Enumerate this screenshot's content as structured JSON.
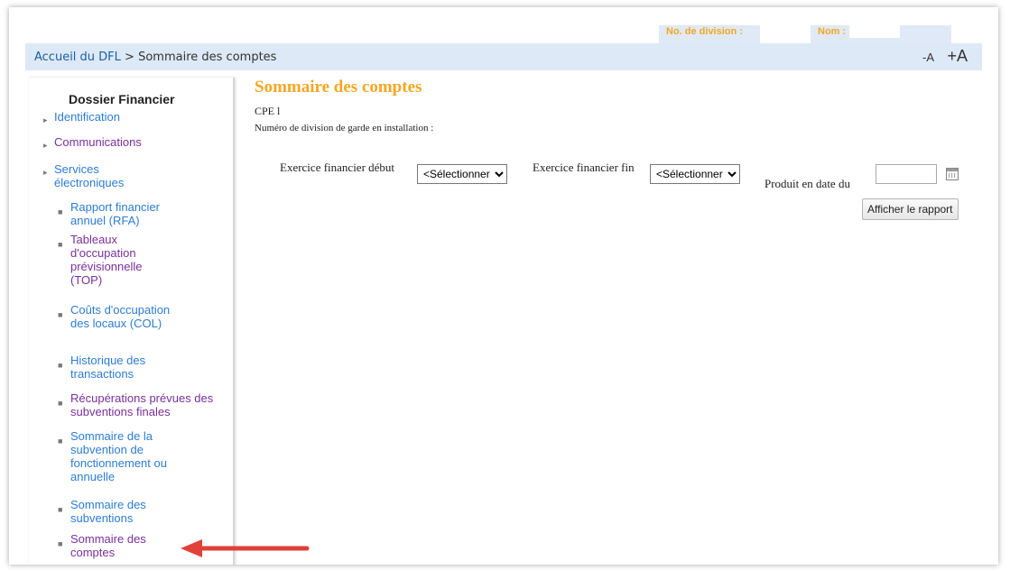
{
  "header": {
    "division_label": "No. de division :",
    "name_label": "Nom :"
  },
  "breadcrumb": {
    "home": "Accueil du DFL",
    "separator": " > ",
    "current": "Sommaire des comptes"
  },
  "font_controls": {
    "decrease": "-A",
    "increase": "+A"
  },
  "sidebar": {
    "title": "Dossier Financier",
    "items": [
      {
        "label": "Identification",
        "color": "blue"
      },
      {
        "label": "Communications",
        "color": "purple"
      },
      {
        "label": "Services électroniques",
        "color": "blue"
      }
    ],
    "subitems": [
      {
        "label": "Rapport financier annuel (RFA)",
        "color": "blue"
      },
      {
        "label": "Tableaux d'occupation prévisionnelle (TOP)",
        "color": "purple"
      },
      {
        "label": "Coûts d'occupation des locaux (COL)",
        "color": "blue"
      },
      {
        "label": "Historique des transactions",
        "color": "blue"
      },
      {
        "label": "Récupérations prévues des subventions finales",
        "color": "purple"
      },
      {
        "label": "Sommaire de la subvention de fonctionnement ou annuelle",
        "color": "blue"
      },
      {
        "label": "Sommaire des subventions",
        "color": "blue"
      },
      {
        "label": "Sommaire des comptes",
        "color": "purple"
      }
    ]
  },
  "main": {
    "title": "Sommaire des comptes",
    "cpe": "CPE l",
    "division_line": "Numéro de division de garde en installation :",
    "fiscal_start_label": "Exercice financier début",
    "fiscal_start_value": "<Sélectionner>",
    "fiscal_end_label": "Exercice financier fin",
    "fiscal_end_value": "<Sélectionner>",
    "date_label": "Produit en date du",
    "date_value": "",
    "show_report_button": "Afficher le rapport"
  },
  "colors": {
    "title_orange": "#f5a623",
    "link_blue": "#2d7cd2",
    "link_purple": "#7a2f9c",
    "breadcrumb_bg": "#dde9f6",
    "arrow_red": "#e2403a"
  }
}
